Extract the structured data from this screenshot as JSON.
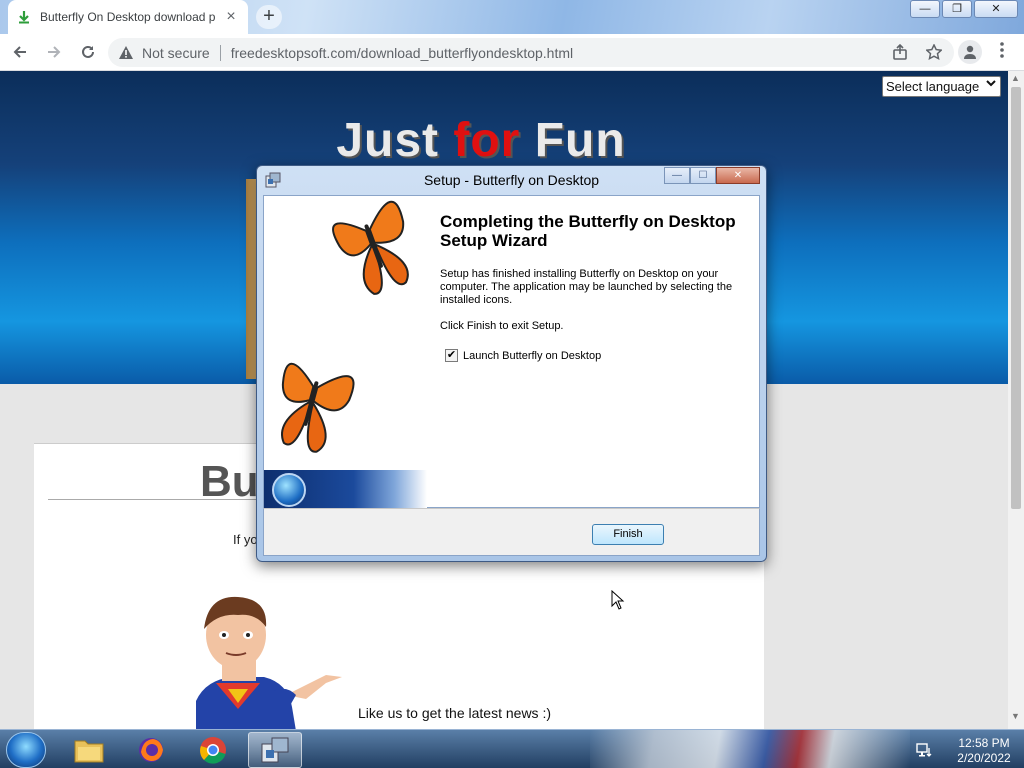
{
  "browser": {
    "tab_title": "Butterfly On Desktop download p",
    "tab_close": "×",
    "new_tab": "+",
    "security_label": "Not secure",
    "url": "freedesktopsoft.com/download_butterflyondesktop.html",
    "window_controls": {
      "minimize": "—",
      "restore": "❐",
      "close": "✕"
    }
  },
  "page": {
    "language_select": "Select language",
    "hero_title_part1": "Just ",
    "hero_title_part2": "for",
    "hero_title_part3": " Fun",
    "card_title": "Bu",
    "card_text": "If yo",
    "like_us": "Like us to get the latest news :)"
  },
  "dialog": {
    "title": "Setup - Butterfly on Desktop",
    "heading": "Completing the Butterfly on Desktop Setup Wizard",
    "paragraph": "Setup has finished installing Butterfly on Desktop on your computer. The application may be launched by selecting the installed icons.",
    "instruction": "Click Finish to exit Setup.",
    "checkbox_label": "Launch Butterfly on Desktop",
    "checkbox_checked": true,
    "finish_button": "Finish"
  },
  "taskbar": {
    "clock_time": "12:58 PM",
    "clock_date": "2/20/2022",
    "apps": [
      "file-explorer-icon",
      "firefox-icon",
      "chrome-icon",
      "setup-installer-icon"
    ]
  },
  "colors": {
    "hero_red": "#e01010",
    "dialog_frame": "#a9c5e7",
    "taskbar": "#223f62"
  }
}
